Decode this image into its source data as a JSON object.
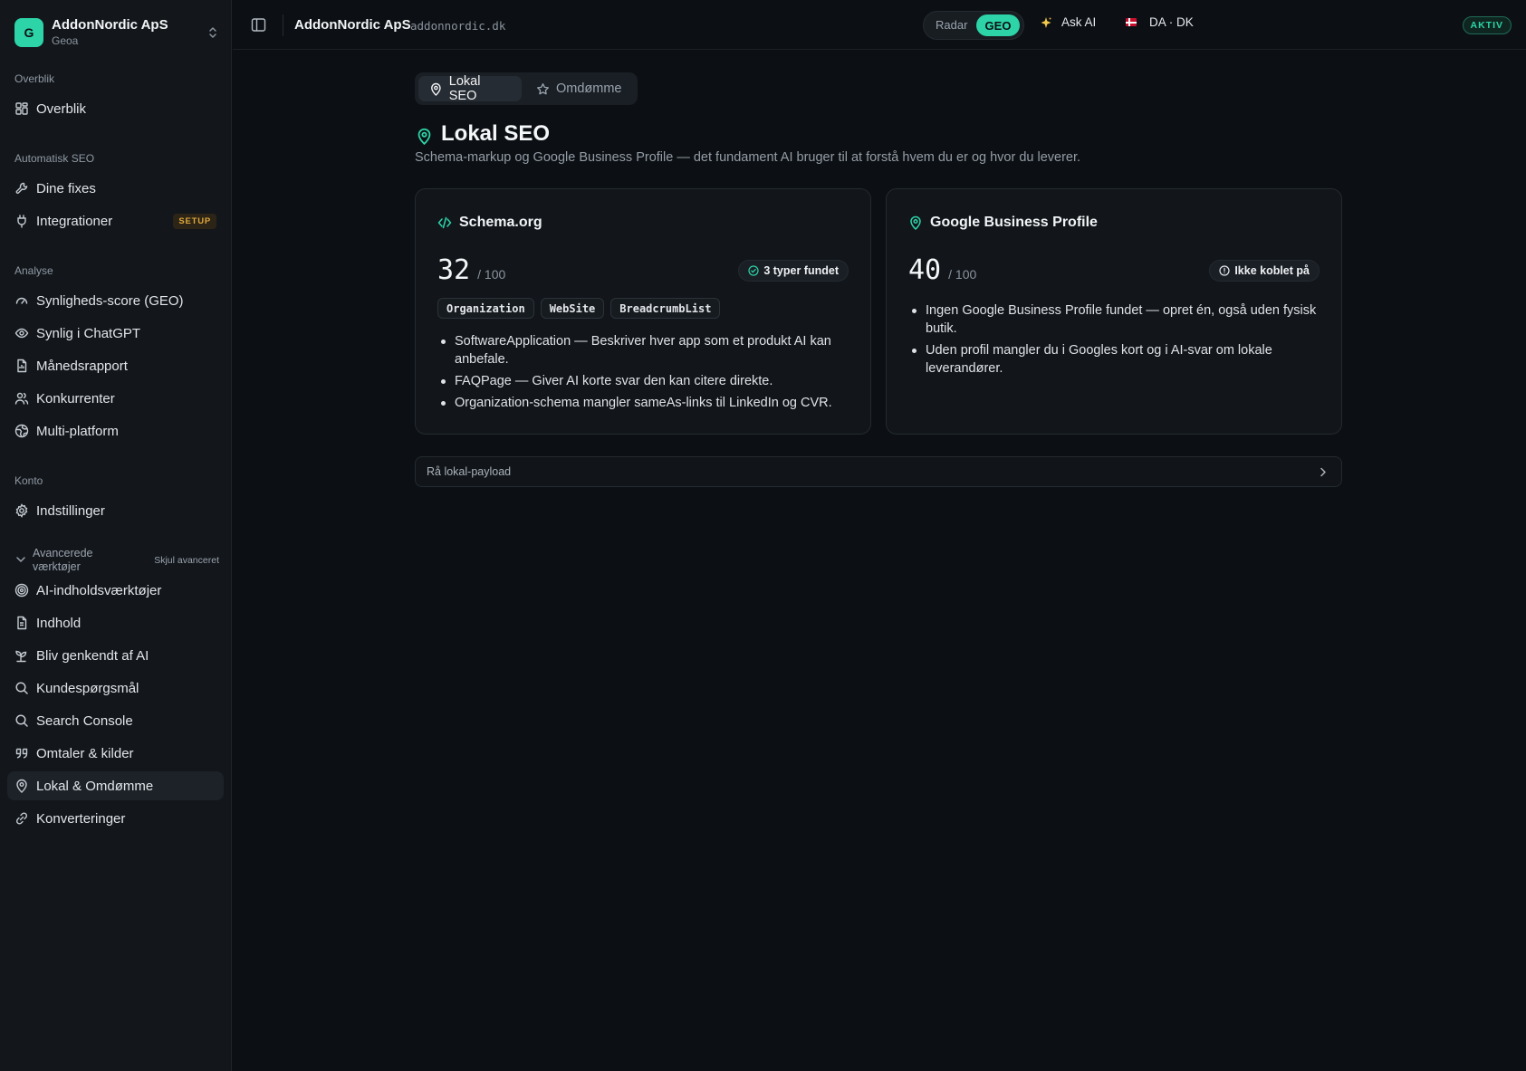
{
  "workspace": {
    "logo_letter": "G",
    "name": "AddonNordic ApS",
    "sub": "Geoa"
  },
  "sidebar": {
    "sections": [
      {
        "title": "Overblik",
        "items": [
          {
            "label": "Overblik",
            "icon": "grid-icon"
          }
        ]
      },
      {
        "title": "Automatisk SEO",
        "items": [
          {
            "label": "Dine fixes",
            "icon": "wrench-icon"
          },
          {
            "label": "Integrationer",
            "icon": "plug-icon",
            "badge": "SETUP"
          }
        ]
      },
      {
        "title": "Analyse",
        "items": [
          {
            "label": "Synligheds-score (GEO)",
            "icon": "gauge-icon"
          },
          {
            "label": "Synlig i ChatGPT",
            "icon": "eye-icon"
          },
          {
            "label": "Månedsrapport",
            "icon": "document-icon"
          },
          {
            "label": "Konkurrenter",
            "icon": "users-icon"
          },
          {
            "label": "Multi-platform",
            "icon": "globe-icon"
          }
        ]
      },
      {
        "title": "Konto",
        "items": [
          {
            "label": "Indstillinger",
            "icon": "gear-icon"
          }
        ]
      }
    ],
    "advanced": {
      "label": "Avancerede værktøjer",
      "hide_label": "Skjul avanceret",
      "items": [
        {
          "label": "AI-indholdsværktøjer",
          "icon": "target-icon"
        },
        {
          "label": "Indhold",
          "icon": "file-text-icon"
        },
        {
          "label": "Bliv genkendt af AI",
          "icon": "sprout-icon"
        },
        {
          "label": "Kundespørgsmål",
          "icon": "search-icon"
        },
        {
          "label": "Search Console",
          "icon": "search-icon"
        },
        {
          "label": "Omtaler & kilder",
          "icon": "quote-icon"
        },
        {
          "label": "Lokal & Omdømme",
          "icon": "map-pin-icon",
          "active": true
        },
        {
          "label": "Konverteringer",
          "icon": "link-icon"
        }
      ]
    }
  },
  "topbar": {
    "site_name": "AddonNordic ApS",
    "domain": "addonnordic.dk",
    "mode_options": [
      "Radar",
      "GEO"
    ],
    "mode_selected": "GEO",
    "ask_ai": "Ask AI",
    "language": "DA · DK",
    "status": "AKTIV"
  },
  "tabs": {
    "active": "Lokal SEO",
    "inactive": "Omdømme"
  },
  "page": {
    "title": "Lokal SEO",
    "subtitle": "Schema-markup og Google Business Profile — det fundament AI bruger til at forstå hvem du er og hvor du leverer."
  },
  "schema_card": {
    "title": "Schema.org",
    "score": "32",
    "score_max": "/ 100",
    "status": "3 typer fundet",
    "tags": [
      "Organization",
      "WebSite",
      "BreadcrumbList"
    ],
    "bullets": [
      "SoftwareApplication — Beskriver hver app som et produkt AI kan anbefale.",
      "FAQPage — Giver AI korte svar den kan citere direkte.",
      "Organization-schema mangler sameAs-links til LinkedIn og CVR."
    ]
  },
  "gbp_card": {
    "title": "Google Business Profile",
    "score": "40",
    "score_max": "/ 100",
    "status": "Ikke koblet på",
    "bullets": [
      "Ingen Google Business Profile fundet — opret én, også uden fysisk butik.",
      "Uden profil mangler du i Googles kort og i AI-svar om lokale leverandører."
    ]
  },
  "payload": {
    "label": "Rå lokal-payload"
  },
  "colors": {
    "accent": "#2dd4a8",
    "background": "#0c1014",
    "badge_setup": "#e0a93c"
  }
}
